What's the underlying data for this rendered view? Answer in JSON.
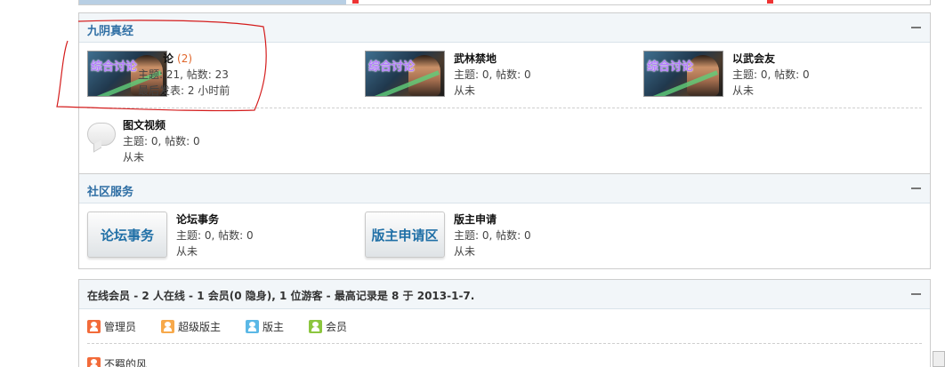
{
  "colors": {
    "accent_title": "#2e6ea4",
    "count_color": "#e0662b",
    "annotation": "#d41c1c"
  },
  "section1": {
    "title": "九阴真经",
    "forums": [
      {
        "thumb_tag": "综合讨论",
        "name": "论",
        "count": "(2)",
        "stats": "主题: 21, 帖数: 23",
        "last": "最后发表: 2 小时前"
      },
      {
        "thumb_tag": "综合讨论",
        "name": "武林禁地",
        "stats": "主题: 0, 帖数: 0",
        "last": "从未"
      },
      {
        "thumb_tag": "综合讨论",
        "name": "以武会友",
        "stats": "主题: 0, 帖数: 0",
        "last": "从未"
      },
      {
        "icon": "speech-bubble-icon",
        "name": "图文视频",
        "stats": "主题: 0, 帖数: 0",
        "last": "从未"
      }
    ]
  },
  "section2": {
    "title": "社区服务",
    "forums": [
      {
        "thumb_label": "论坛事务",
        "name": "论坛事务",
        "stats": "主题: 0, 帖数: 0",
        "last": "从未"
      },
      {
        "thumb_label": "版主申请区",
        "name": "版主申请",
        "stats": "主题: 0, 帖数: 0",
        "last": "从未"
      }
    ]
  },
  "online": {
    "title": "在线会员",
    "summary": " - 2 人在线 - 1 会员(0 隐身), 1 位游客 - 最高记录是 8 于 2013-1-7.",
    "legend": [
      {
        "label": "管理员",
        "color": "#f26b3a"
      },
      {
        "label": "超级版主",
        "color": "#f7a94b"
      },
      {
        "label": "版主",
        "color": "#5bb8e6"
      },
      {
        "label": "会员",
        "color": "#8cc63f"
      }
    ],
    "member": "不羁的风"
  }
}
